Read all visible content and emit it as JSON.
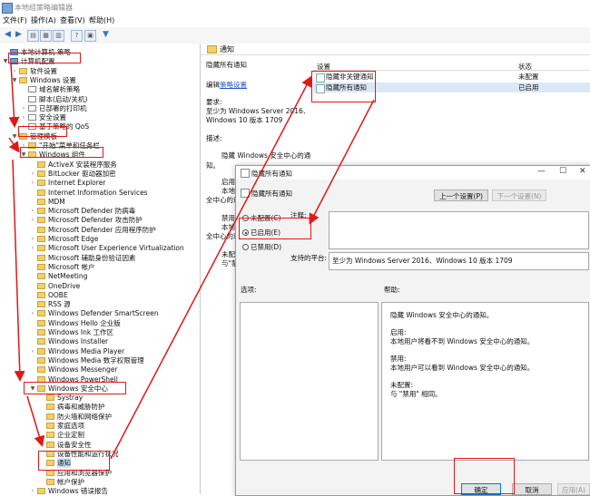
{
  "window": {
    "title": "本地组策略编辑器"
  },
  "menu": [
    "文件(F)",
    "操作(A)",
    "查看(V)",
    "帮助(H)"
  ],
  "tree": [
    {
      "label": "本地计算机 策略",
      "level": 0,
      "exp": "",
      "icon": "comp"
    },
    {
      "label": "计算机配置",
      "level": 0,
      "exp": "▼",
      "icon": "comp"
    },
    {
      "label": "软件设置",
      "level": 1,
      "exp": "›",
      "icon": "folder"
    },
    {
      "label": "Windows 设置",
      "level": 1,
      "exp": "▼",
      "icon": "folder"
    },
    {
      "label": "域名解析策略",
      "level": 2,
      "exp": "",
      "icon": "doc"
    },
    {
      "label": "脚本(启动/关机)",
      "level": 2,
      "exp": "",
      "icon": "doc"
    },
    {
      "label": "已部署的打印机",
      "level": 2,
      "exp": "›",
      "icon": "doc"
    },
    {
      "label": "安全设置",
      "level": 2,
      "exp": "›",
      "icon": "doc"
    },
    {
      "label": "基于策略的 QoS",
      "level": 2,
      "exp": "›",
      "icon": "doc"
    },
    {
      "label": "管理模板",
      "level": 1,
      "exp": "▼",
      "icon": "folder"
    },
    {
      "label": "\"开始\"菜单和任务栏",
      "level": 2,
      "exp": "›",
      "icon": "folder"
    },
    {
      "label": "Windows 组件",
      "level": 2,
      "exp": "▼",
      "icon": "folder"
    },
    {
      "label": "ActiveX 安装程序服务",
      "level": 3,
      "exp": "",
      "icon": "folder"
    },
    {
      "label": "BitLocker 驱动器加密",
      "level": 3,
      "exp": "›",
      "icon": "folder"
    },
    {
      "label": "Internet Explorer",
      "level": 3,
      "exp": "›",
      "icon": "folder"
    },
    {
      "label": "Internet Information Services",
      "level": 3,
      "exp": "",
      "icon": "folder"
    },
    {
      "label": "MDM",
      "level": 3,
      "exp": "",
      "icon": "folder"
    },
    {
      "label": "Microsoft Defender 防病毒",
      "level": 3,
      "exp": "›",
      "icon": "folder"
    },
    {
      "label": "Microsoft Defender 攻击防护",
      "level": 3,
      "exp": "›",
      "icon": "folder"
    },
    {
      "label": "Microsoft Defender 应用程序防护",
      "level": 3,
      "exp": "",
      "icon": "folder"
    },
    {
      "label": "Microsoft Edge",
      "level": 3,
      "exp": "›",
      "icon": "folder"
    },
    {
      "label": "Microsoft User Experience Virtualization",
      "level": 3,
      "exp": "›",
      "icon": "folder"
    },
    {
      "label": "Microsoft 辅助身份验证因素",
      "level": 3,
      "exp": "",
      "icon": "folder"
    },
    {
      "label": "Microsoft 帐户",
      "level": 3,
      "exp": "",
      "icon": "folder"
    },
    {
      "label": "NetMeeting",
      "level": 3,
      "exp": "",
      "icon": "folder"
    },
    {
      "label": "OneDrive",
      "level": 3,
      "exp": "",
      "icon": "folder"
    },
    {
      "label": "OOBE",
      "level": 3,
      "exp": "",
      "icon": "folder"
    },
    {
      "label": "RSS 源",
      "level": 3,
      "exp": "",
      "icon": "folder"
    },
    {
      "label": "Windows Defender SmartScreen",
      "level": 3,
      "exp": "›",
      "icon": "folder"
    },
    {
      "label": "Windows Hello 企业版",
      "level": 3,
      "exp": "",
      "icon": "folder"
    },
    {
      "label": "Windows Ink 工作区",
      "level": 3,
      "exp": "",
      "icon": "folder"
    },
    {
      "label": "Windows Installer",
      "level": 3,
      "exp": "",
      "icon": "folder"
    },
    {
      "label": "Windows Media Player",
      "level": 3,
      "exp": "›",
      "icon": "folder"
    },
    {
      "label": "Windows Media 数字权限管理",
      "level": 3,
      "exp": "",
      "icon": "folder"
    },
    {
      "label": "Windows Messenger",
      "level": 3,
      "exp": "",
      "icon": "folder"
    },
    {
      "label": "Windows PowerShell",
      "level": 3,
      "exp": "",
      "icon": "folder"
    },
    {
      "label": "Windows 安全中心",
      "level": 3,
      "exp": "▼",
      "icon": "folder"
    },
    {
      "label": "Systray",
      "level": 4,
      "exp": "",
      "icon": "folder"
    },
    {
      "label": "病毒和威胁防护",
      "level": 4,
      "exp": "",
      "icon": "folder"
    },
    {
      "label": "防火墙和网络保护",
      "level": 4,
      "exp": "",
      "icon": "folder"
    },
    {
      "label": "家庭选项",
      "level": 4,
      "exp": "",
      "icon": "folder"
    },
    {
      "label": "企业定制",
      "level": 4,
      "exp": "",
      "icon": "folder"
    },
    {
      "label": "设备安全性",
      "level": 4,
      "exp": "",
      "icon": "folder"
    },
    {
      "label": "设备性能和运行状况",
      "level": 4,
      "exp": "",
      "icon": "folder"
    },
    {
      "label": "通知",
      "level": 4,
      "exp": "",
      "icon": "folder",
      "selected": true
    },
    {
      "label": "应用和浏览器保护",
      "level": 4,
      "exp": "",
      "icon": "folder"
    },
    {
      "label": "帐户保护",
      "level": 4,
      "exp": "",
      "icon": "folder"
    },
    {
      "label": "Windows 错误报告",
      "level": 3,
      "exp": "›",
      "icon": "folder"
    }
  ],
  "pane": {
    "header": "通知",
    "policy_title": "隐藏所有通知",
    "edit_prefix": "编辑",
    "edit_link": "策略设置",
    "req_label": "要求:",
    "req_line1": "至少为 Windows Server 2016、",
    "req_line2": "Windows 10 版本 1709",
    "desc_label": "描述:",
    "desc_1": "隐藏 Windows 安全中心的通",
    "desc_2": "知。",
    "frag_1": "启用:",
    "frag_2": "本地用",
    "frag_3": "全中心的通",
    "frag_4": "禁用:",
    "frag_5": "本地",
    "frag_6": "全中心的通",
    "frag_7": "未配置:",
    "frag_8": "与\"禁"
  },
  "list": {
    "col_setting": "设置",
    "col_state": "状态",
    "rows": [
      {
        "name": "隐藏非关键通知",
        "state": "未配置"
      },
      {
        "name": "隐藏所有通知",
        "state": "已启用",
        "selected": true
      }
    ]
  },
  "dialog": {
    "title": "隐藏所有通知",
    "setting_name": "隐藏所有通知",
    "prev_btn": "上一个设置(P)",
    "next_btn": "下一个设置(N)",
    "radio_notconfig": "未配置(C)",
    "radio_enabled": "已启用(E)",
    "radio_disabled": "已禁用(D)",
    "comment_label": "注释:",
    "platform_label": "支持的平台:",
    "platform_value": "至少为 Windows Server 2016、Windows 10 版本 1709",
    "options_label": "选项:",
    "help_label": "帮助:",
    "help_lines": [
      "隐藏 Windows 安全中心的通知。",
      "",
      "启用:",
      "本地用户将看不到 Windows 安全中心的通知。",
      "",
      "禁用:",
      "本地用户可以看到 Windows 安全中心的通知。",
      "",
      "未配置:",
      "与 \"禁用\" 相同。"
    ],
    "ok_btn": "确定",
    "cancel_btn": "取消",
    "apply_btn": "应用(A)",
    "selected_option": "enabled"
  },
  "colors": {
    "annotation": "#e01818",
    "link": "#2255cc",
    "selection": "#cce4f7"
  }
}
